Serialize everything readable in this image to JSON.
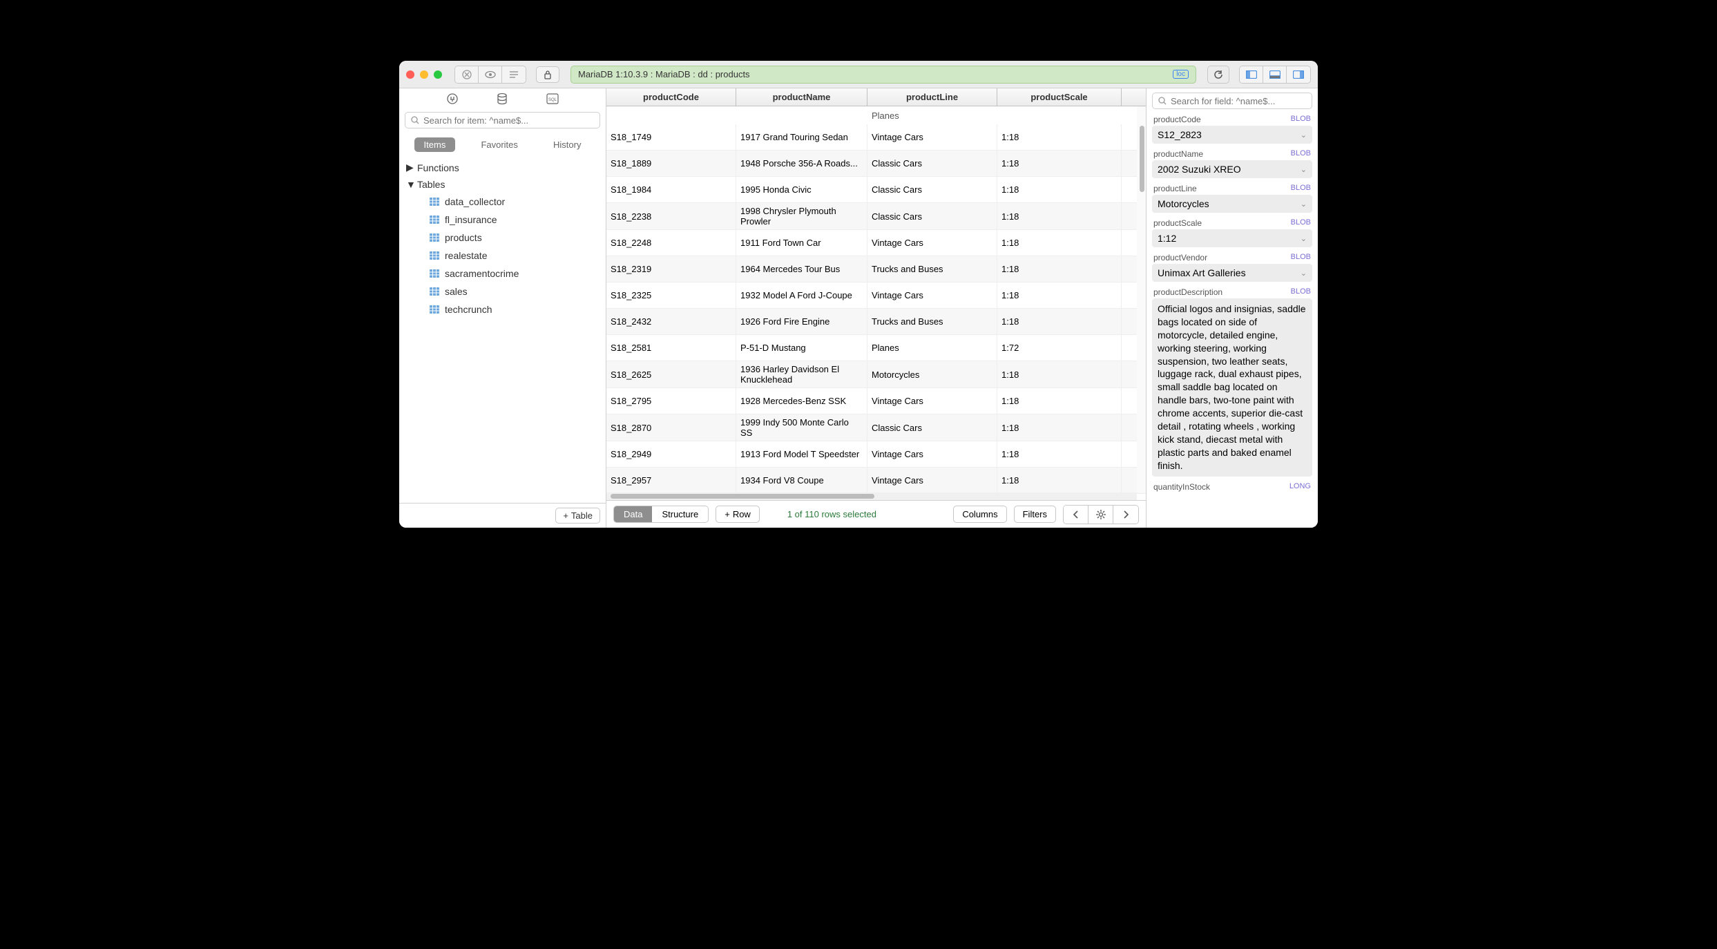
{
  "titlebar": {
    "breadcrumb": "MariaDB 1:10.3.9 : MariaDB : dd : products",
    "loc_badge": "loc"
  },
  "sidebar": {
    "search_placeholder": "Search for item: ^name$...",
    "tabs": {
      "items": "Items",
      "favorites": "Favorites",
      "history": "History"
    },
    "tree": {
      "functions": "Functions",
      "tables": "Tables",
      "tables_list": [
        "data_collector",
        "fl_insurance",
        "products",
        "realestate",
        "sacramentocrime",
        "sales",
        "techcrunch"
      ]
    },
    "add_table": "Table"
  },
  "grid": {
    "columns": [
      "productCode",
      "productName",
      "productLine",
      "productScale"
    ],
    "rows": [
      {
        "code": "S18_1749",
        "name": "1917 Grand Touring Sedan",
        "line": "Vintage Cars",
        "scale": "1:18"
      },
      {
        "code": "S18_1889",
        "name": "1948 Porsche 356-A Roads...",
        "line": "Classic Cars",
        "scale": "1:18"
      },
      {
        "code": "S18_1984",
        "name": "1995 Honda Civic",
        "line": "Classic Cars",
        "scale": "1:18"
      },
      {
        "code": "S18_2238",
        "name": "1998 Chrysler Plymouth Prowler",
        "line": "Classic Cars",
        "scale": "1:18"
      },
      {
        "code": "S18_2248",
        "name": "1911 Ford Town Car",
        "line": "Vintage Cars",
        "scale": "1:18"
      },
      {
        "code": "S18_2319",
        "name": "1964 Mercedes Tour Bus",
        "line": "Trucks and Buses",
        "scale": "1:18"
      },
      {
        "code": "S18_2325",
        "name": "1932 Model A Ford J-Coupe",
        "line": "Vintage Cars",
        "scale": "1:18"
      },
      {
        "code": "S18_2432",
        "name": "1926 Ford Fire Engine",
        "line": "Trucks and Buses",
        "scale": "1:18"
      },
      {
        "code": "S18_2581",
        "name": "P-51-D Mustang",
        "line": "Planes",
        "scale": "1:72"
      },
      {
        "code": "S18_2625",
        "name": "1936 Harley Davidson El Knucklehead",
        "line": "Motorcycles",
        "scale": "1:18"
      },
      {
        "code": "S18_2795",
        "name": "1928 Mercedes-Benz SSK",
        "line": "Vintage Cars",
        "scale": "1:18"
      },
      {
        "code": "S18_2870",
        "name": "1999 Indy 500 Monte Carlo SS",
        "line": "Classic Cars",
        "scale": "1:18"
      },
      {
        "code": "S18_2949",
        "name": "1913 Ford Model T Speedster",
        "line": "Vintage Cars",
        "scale": "1:18"
      },
      {
        "code": "S18_2957",
        "name": "1934 Ford V8 Coupe",
        "line": "Vintage Cars",
        "scale": "1:18"
      }
    ],
    "partial_line": "Planes"
  },
  "footer": {
    "data": "Data",
    "structure": "Structure",
    "row": "Row",
    "status": "1 of 110 rows selected",
    "columns": "Columns",
    "filters": "Filters"
  },
  "inspector": {
    "search_placeholder": "Search for field: ^name$...",
    "fields": {
      "productCode": {
        "label": "productCode",
        "type": "BLOB",
        "value": "S12_2823"
      },
      "productName": {
        "label": "productName",
        "type": "BLOB",
        "value": "2002 Suzuki XREO"
      },
      "productLine": {
        "label": "productLine",
        "type": "BLOB",
        "value": "Motorcycles"
      },
      "productScale": {
        "label": "productScale",
        "type": "BLOB",
        "value": "1:12"
      },
      "productVendor": {
        "label": "productVendor",
        "type": "BLOB",
        "value": "Unimax Art Galleries"
      },
      "productDescription": {
        "label": "productDescription",
        "type": "BLOB",
        "value": "Official logos and insignias, saddle bags located on side of motorcycle, detailed engine, working steering, working suspension, two leather seats, luggage rack, dual exhaust pipes, small saddle bag located on handle bars, two-tone paint with chrome accents, superior die-cast detail , rotating wheels , working kick stand, diecast metal with plastic parts and baked enamel finish."
      },
      "quantityInStock": {
        "label": "quantityInStock",
        "type": "LONG"
      }
    }
  }
}
